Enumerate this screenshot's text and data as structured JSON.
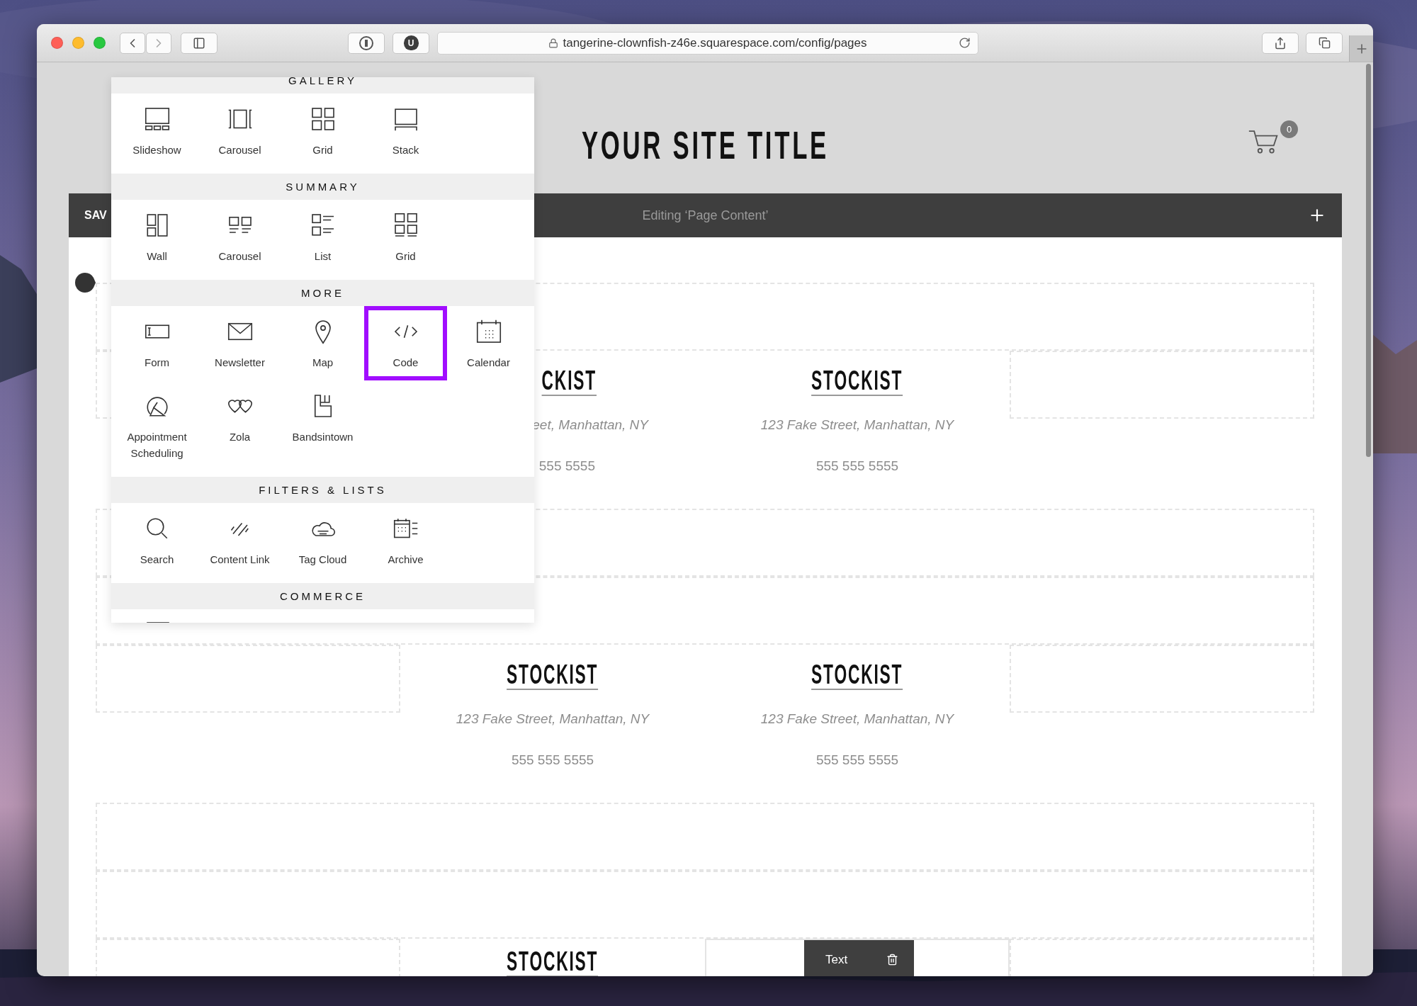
{
  "browser": {
    "extension_badge": "U",
    "url": "tangerine-clownfish-z46e.squarespace.com/config/pages"
  },
  "site_title": "YOUR SITE TITLE",
  "cart": {
    "count": "0"
  },
  "editor_bar": {
    "save_label": "SAV",
    "title": "Editing ‘Page Content’"
  },
  "block_menu": {
    "sections": [
      {
        "title": "GALLERY",
        "items": [
          {
            "label": "Slideshow",
            "selected": false
          },
          {
            "label": "Carousel",
            "selected": false
          },
          {
            "label": "Grid",
            "selected": false
          },
          {
            "label": "Stack",
            "selected": false
          }
        ]
      },
      {
        "title": "SUMMARY",
        "items": [
          {
            "label": "Wall",
            "selected": false
          },
          {
            "label": "Carousel",
            "selected": false
          },
          {
            "label": "List",
            "selected": false
          },
          {
            "label": "Grid",
            "selected": false
          }
        ]
      },
      {
        "title": "MORE",
        "items": [
          {
            "label": "Form",
            "selected": false
          },
          {
            "label": "Newsletter",
            "selected": false
          },
          {
            "label": "Map",
            "selected": false
          },
          {
            "label": "Code",
            "selected": true
          },
          {
            "label": "Calendar",
            "selected": false
          },
          {
            "label": "Appointment Scheduling",
            "selected": false
          },
          {
            "label": "Zola",
            "selected": false
          },
          {
            "label": "Bandsintown",
            "selected": false
          }
        ]
      },
      {
        "title": "FILTERS & LISTS",
        "items": [
          {
            "label": "Search",
            "selected": false
          },
          {
            "label": "Content Link",
            "selected": false
          },
          {
            "label": "Tag Cloud",
            "selected": false
          },
          {
            "label": "Archive",
            "selected": false
          }
        ]
      },
      {
        "title": "COMMERCE"
      }
    ]
  },
  "stockist_rows": [
    {
      "stockists": [
        {
          "kind": "partial",
          "title": "CKIST",
          "address": "eet, Manhattan, NY",
          "phone": "555 5555"
        },
        {
          "kind": "full",
          "title": "STOCKIST",
          "address": "123 Fake Street, Manhattan, NY",
          "phone": "555 555 5555"
        }
      ]
    },
    {
      "stockists": [
        {
          "kind": "full",
          "title": "STOCKIST",
          "address": "123 Fake Street, Manhattan, NY",
          "phone": "555 555 5555"
        },
        {
          "kind": "full",
          "title": "STOCKIST",
          "address": "123 Fake Street, Manhattan, NY",
          "phone": "555 555 5555"
        }
      ]
    },
    {
      "stockists": [
        {
          "kind": "full",
          "title": "STOCKIST"
        }
      ],
      "toolbar": {
        "label": "Text"
      }
    }
  ]
}
